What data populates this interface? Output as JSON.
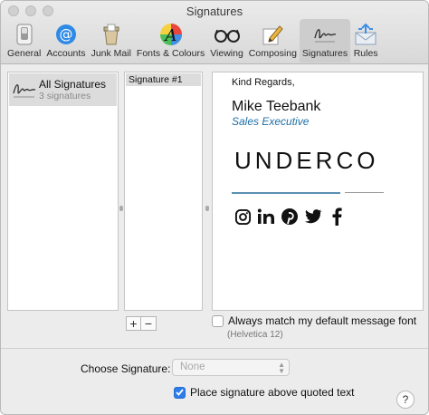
{
  "window": {
    "title": "Signatures"
  },
  "toolbar": {
    "items": [
      {
        "label": "General",
        "icon": "general-switch-icon"
      },
      {
        "label": "Accounts",
        "icon": "at-sign-icon"
      },
      {
        "label": "Junk Mail",
        "icon": "junk-mail-icon"
      },
      {
        "label": "Fonts & Colours",
        "icon": "fonts-colours-icon"
      },
      {
        "label": "Viewing",
        "icon": "glasses-icon"
      },
      {
        "label": "Composing",
        "icon": "pencil-paper-icon"
      },
      {
        "label": "Signatures",
        "icon": "signature-icon",
        "active": true
      },
      {
        "label": "Rules",
        "icon": "rules-envelope-icon"
      }
    ]
  },
  "accounts": {
    "selected": {
      "title": "All Signatures",
      "subtitle": "3 signatures"
    }
  },
  "signatures": {
    "items": [
      {
        "label": "Signature #1"
      }
    ]
  },
  "preview": {
    "greeting": "Kind Regards,",
    "name": "Mike Teebank",
    "role": "Sales Executive",
    "logo": "UNDERCO",
    "social": [
      "instagram-icon",
      "linkedin-icon",
      "pinterest-icon",
      "twitter-icon",
      "facebook-icon"
    ]
  },
  "controls": {
    "add": "+",
    "remove": "−",
    "match_font_label": "Always match my default message font",
    "match_font_checked": false,
    "font_hint": "(Helvetica 12)",
    "choose_label": "Choose Signature:",
    "choose_value": "None",
    "place_above_label": "Place signature above quoted text",
    "place_above_checked": true,
    "help": "?"
  },
  "colors": {
    "accent": "#2b7de9",
    "role_text": "#1f6fa8",
    "divider": "#5b8fb3"
  }
}
